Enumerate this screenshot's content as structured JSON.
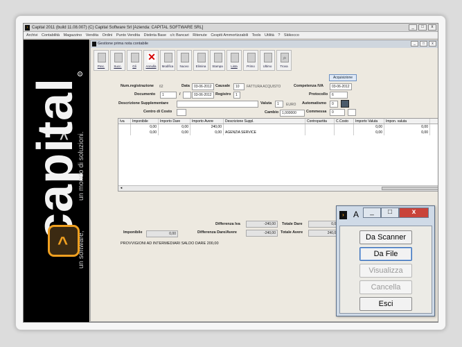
{
  "app": {
    "title": "Capital 2011 (build 11.08.007) (C) Capital Software Srl [Azienda: CAPITAL SOFTWARE SRL]",
    "window_controls": [
      "_",
      "□",
      "x"
    ],
    "menu": [
      "Archivi",
      "Contabilità",
      "Magazzino",
      "Vendita",
      "Ordini",
      "Punto Vendita",
      "Distinta Base",
      "c/c Bancari",
      "Ritenute",
      "Cespiti Ammortizzabili",
      "Tools",
      "Utilità",
      "?",
      "Skikocco"
    ]
  },
  "branding": {
    "name": "capital",
    "caret": "^",
    "tagline1": "un mondo di soluzioni.",
    "tagline2": "un software,",
    "registered": "®"
  },
  "form": {
    "window_title": "Gestione prima nota contabile",
    "toolbar": [
      "Prec.",
      "Succ.",
      "Gli",
      "Annulla",
      "Modifica",
      "Nuovo",
      "Elimina",
      "Stampa",
      "Lista",
      "Primo",
      "Ultimo",
      "Trova"
    ],
    "acquisizione": "Acquisizione",
    "labels": {
      "num_reg": "Num.registrazione",
      "data": "Data",
      "causale": "Causale",
      "competenza_iva": "Competenza IVA",
      "documento": "Documento",
      "registro": "Registro",
      "protocollo": "Protocollo",
      "descr_suppl": "Descrizione Supplementare",
      "valuta": "Valuta",
      "automatismo": "Automatismo",
      "centro_costo": "Centro di Costo",
      "cambio": "Cambio",
      "commessa": "Commessa"
    },
    "values": {
      "num_reg": "62",
      "data": "03-06-2012",
      "causale_code": "10",
      "causale_desc": "FATTURA ACQUISTO",
      "competenza_iva": "03-06-2012",
      "documento": "1",
      "doc_sep": "/",
      "doc_data": "03-06-2012",
      "registro": "1",
      "protocollo": "6",
      "descr_suppl": "",
      "valuta_code": "1",
      "valuta_name": "EURO",
      "automatismo": "0",
      "centro_costo": "",
      "cambio": "1,000000",
      "commessa": "0"
    },
    "grid": {
      "headers": [
        "Iva",
        "Imponibile",
        "Importo Dare",
        "Importo Avere",
        "Descrizione Suppl.",
        "Contropartita",
        "C.Costo",
        "Importo Valuta",
        "Impon. valuta"
      ],
      "rows": [
        [
          "",
          "0,00",
          "0,00",
          "240,00",
          "",
          "",
          "",
          "0,00",
          "0,00"
        ],
        [
          "",
          "0,00",
          "0,00",
          "0,00",
          "AGENZIA SERVICE",
          "",
          "",
          "0,00",
          "0,00"
        ]
      ]
    },
    "totals": {
      "differenza_iva_label": "Differenza Iva",
      "differenza_iva": "-240,00",
      "totale_dare_label": "Totale Dare",
      "totale_dare": "0,00",
      "imponibile_label": "Imponibile",
      "imponibile": "0,00",
      "diff_dare_avere_label": "Differenza Dare/Avere",
      "diff_dare_avere": "-240,00",
      "totale_avere_label": "Totale Avere",
      "totale_avere": "240,00"
    },
    "note": "PROVVIGIONI AD INTERMEDIARI SALDO DARE 200,00"
  },
  "dialog": {
    "title": "A",
    "buttons": {
      "scanner": "Da Scanner",
      "file": "Da File",
      "visualizza": "Visualizza",
      "cancella": "Cancella",
      "esci": "Esci"
    }
  },
  "colors": {
    "sidebar_bg": "#000000",
    "logo_accent": "#f0a020",
    "dialog_close": "#c9443a",
    "form_bg": "#ede9e0"
  }
}
